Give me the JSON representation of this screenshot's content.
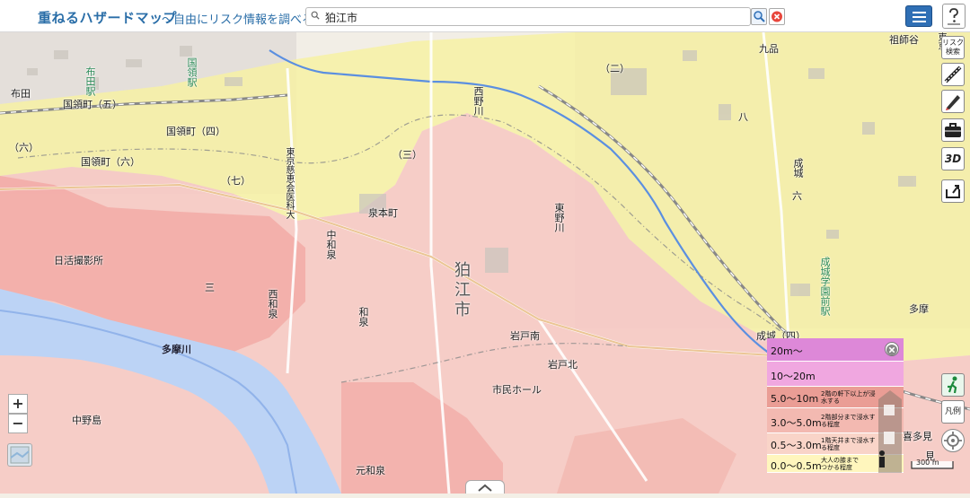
{
  "header": {
    "title": "重ねるハザードマップ",
    "subtitle": "〜自由にリスク情報を調べる〜",
    "search_value": "狛江市",
    "search_icon": "search-icon",
    "clear_icon": "close-icon",
    "menu_icon": "hamburger-menu-icon",
    "help_icon": "help-icon"
  },
  "colors": {
    "header_title": "#2a6ea8",
    "flood_light_yellow": "#f7f1a3",
    "flood_pink": "#f6c9c3",
    "flood_red": "#f1a5a2",
    "river": "#bcd3f5",
    "menu_button": "#2f6fb5"
  },
  "map": {
    "city_label": "狛江市",
    "labels": {
      "nunoda": "布田",
      "nunoda_station": "布田駅",
      "kokuryo_station": "国領駅",
      "kokuryo5": "国領町（五）",
      "kokuryo4": "国領町（四）",
      "kokuryo6": "国領町（六）",
      "roku": "（六）",
      "nana": "（七）",
      "izumihoncho": "泉本町",
      "nakaizumi": "中和泉",
      "nishiizumi": "西和泉",
      "izumi": "和泉",
      "motoizumi": "元和泉",
      "higashinogawa": "東野川",
      "nishinogawa": "西野川",
      "iwadokita": "岩戸北",
      "iwadominami": "岩戸南",
      "seijo": "成城",
      "seijo_station": "成城学園前駅",
      "seijo4": "成城（四）",
      "kuhon": "九品",
      "kitami": "喜多見",
      "tamagawa": "多摩川",
      "nakanoshima": "中野島",
      "nikkatsu": "日活撮影所",
      "tokyo_jikei": "東京慈恵会医科大",
      "shiminhall": "市民ホール",
      "sodegasaki": "祖師谷",
      "tokyo_lbl": "東京",
      "ni": "（二）",
      "san": "（三）",
      "hachi": "八",
      "roku_kanji": "六",
      "san_kanji": "三",
      "tama": "多摩",
      "mi": "見"
    }
  },
  "toolbar": {
    "risk_search_label": "リスク検索",
    "ruler_icon": "ruler-icon",
    "pen_icon": "pen-icon",
    "briefcase_icon": "briefcase-icon",
    "threed_label": "3D",
    "share_icon": "share-icon",
    "evacuation_icon": "evacuation-icon",
    "legend_label": "凡例",
    "location_icon": "current-location-icon"
  },
  "legend": {
    "close_icon": "close-icon",
    "rows": [
      {
        "value": "20m～",
        "desc": "",
        "color": "#dd88d8"
      },
      {
        "value": "10～20m",
        "desc": "",
        "color": "#f0a7e0"
      },
      {
        "value": "5.0～10m",
        "desc": "2階の軒下以上が浸水する",
        "color": "#ea9d95"
      },
      {
        "value": "3.0～5.0m",
        "desc": "2階部分まで浸水する程度",
        "color": "#f3b9b1"
      },
      {
        "value": "0.5～3.0m",
        "desc": "1階天井まで浸水する程度",
        "color": "#f9d4c8"
      },
      {
        "value": "0.0～0.5m",
        "desc": "大人の膝まで\nつかる程度",
        "color": "#fff6bd"
      }
    ]
  },
  "zoom": {
    "in_label": "+",
    "out_label": "−"
  },
  "scale": {
    "label": "300 m"
  },
  "bottom_toggle_icon": "chevron-up-icon",
  "layer_toggle_icon": "layer-map-icon"
}
